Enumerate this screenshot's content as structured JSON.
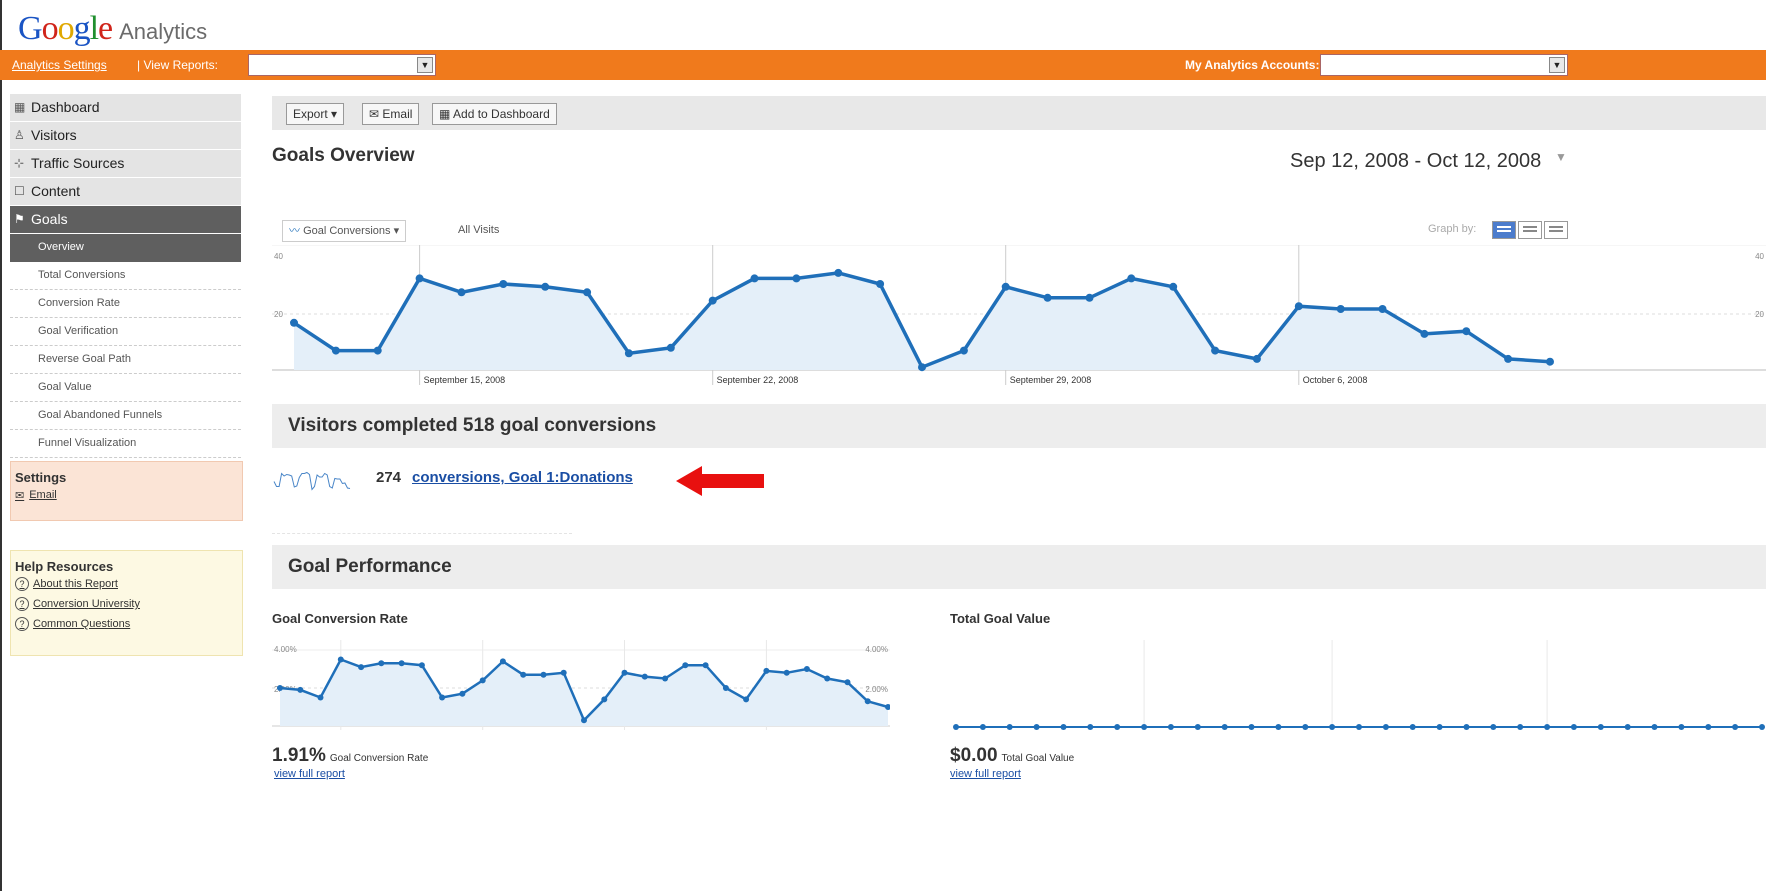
{
  "header": {
    "logo_google": "Google",
    "logo_analytics": "Analytics",
    "settings_link": "Analytics Settings",
    "view_reports_label": "| View Reports:",
    "accounts_label": "My Analytics Accounts:"
  },
  "sidebar": {
    "nav": [
      {
        "label": "Dashboard",
        "icon": "dashboard-icon"
      },
      {
        "label": "Visitors",
        "icon": "visitors-icon"
      },
      {
        "label": "Traffic Sources",
        "icon": "traffic-sources-icon"
      },
      {
        "label": "Content",
        "icon": "content-icon"
      },
      {
        "label": "Goals",
        "icon": "flag-icon"
      }
    ],
    "goals_sub": [
      "Overview",
      "Total Conversions",
      "Conversion Rate",
      "Goal Verification",
      "Reverse Goal Path",
      "Goal Value",
      "Goal Abandoned Funnels",
      "Funnel Visualization"
    ],
    "settings": {
      "title": "Settings",
      "email": "Email"
    },
    "help": {
      "title": "Help Resources",
      "links": [
        "About this Report",
        "Conversion University",
        "Common Questions"
      ]
    }
  },
  "toolbar": {
    "export": "Export",
    "email": "Email",
    "add_dashboard": "Add to Dashboard"
  },
  "page_title": "Goals Overview",
  "date_range": "Sep 12, 2008 - Oct 12, 2008",
  "graph_controls": {
    "metric": "Goal Conversions",
    "vs": "All Visits",
    "graph_by": "Graph by:"
  },
  "main_chart": {
    "type": "area",
    "ylabels_left": [
      "40",
      "20"
    ],
    "ylabels_right": [
      "40",
      "20"
    ],
    "x_labels": [
      "September 15, 2008",
      "September 22, 2008",
      "September 29, 2008",
      "October 6, 2008"
    ],
    "ylim": [
      0,
      40
    ],
    "values": [
      17,
      7,
      7,
      33,
      28,
      31,
      30,
      28,
      6,
      8,
      25,
      33,
      33,
      35,
      31,
      1,
      7,
      30,
      26,
      26,
      33,
      30,
      7,
      4,
      23,
      22,
      22,
      13,
      14,
      4,
      3
    ],
    "line_color": "#1f6fb9",
    "fill_color": "#e4eff9"
  },
  "conversions_heading": "Visitors completed 518 goal conversions",
  "goal_row": {
    "count": "274",
    "link": "conversions, Goal 1:Donations"
  },
  "goal_performance": {
    "heading": "Goal Performance",
    "rate_title": "Goal Conversion Rate",
    "value_title": "Total Goal Value",
    "rate_stat": "1.91%",
    "rate_stat_label": "Goal Conversion Rate",
    "value_stat": "$0.00",
    "value_stat_label": "Total Goal Value",
    "view_full_report": "view full report",
    "rate_ylabels_left": [
      "4.00%",
      "2.00%"
    ],
    "rate_ylabels_right": [
      "4.00%",
      "2.00%"
    ]
  },
  "chart_data": [
    {
      "type": "line",
      "title": "Goal Conversion Rate",
      "ylim": [
        0,
        4
      ],
      "values": [
        2.0,
        1.9,
        1.5,
        3.5,
        3.1,
        3.3,
        3.3,
        3.2,
        1.5,
        1.7,
        2.4,
        3.4,
        2.7,
        2.7,
        2.8,
        0.3,
        1.4,
        2.8,
        2.6,
        2.5,
        3.2,
        3.2,
        2.0,
        1.4,
        2.9,
        2.8,
        3.0,
        2.5,
        2.3,
        1.3,
        1.0
      ]
    },
    {
      "type": "line",
      "title": "Total Goal Value",
      "ylim": [
        0,
        1
      ],
      "values": [
        0,
        0,
        0,
        0,
        0,
        0,
        0,
        0,
        0,
        0,
        0,
        0,
        0,
        0,
        0,
        0,
        0,
        0,
        0,
        0,
        0,
        0,
        0,
        0,
        0,
        0,
        0,
        0,
        0,
        0,
        0
      ]
    }
  ]
}
